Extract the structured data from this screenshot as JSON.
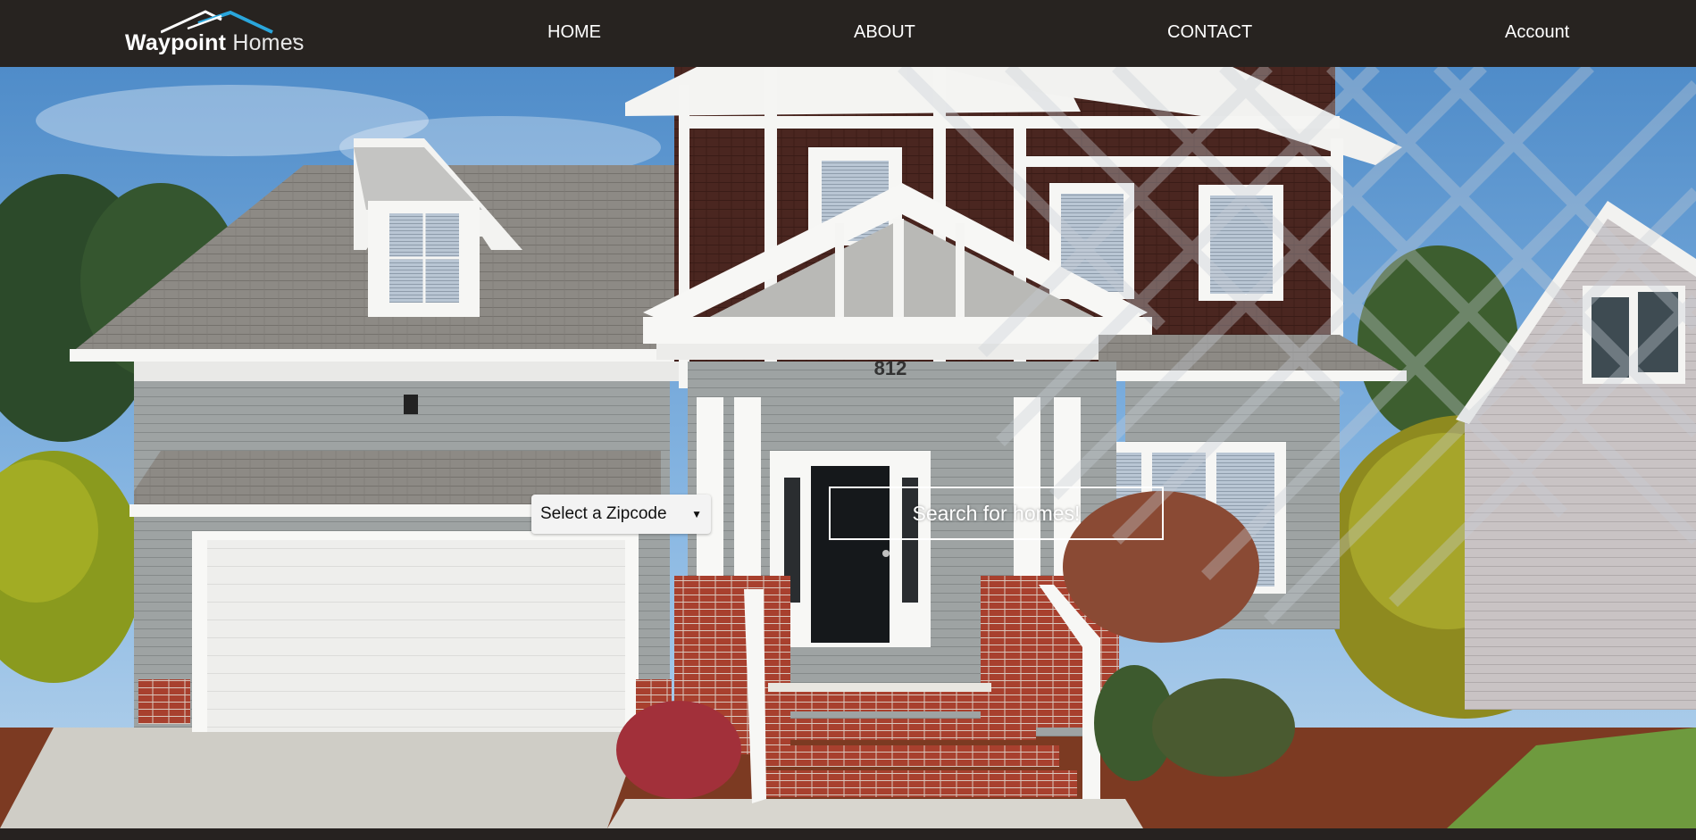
{
  "brand": {
    "name_part1": "Waypoint",
    "name_part2": "Homes",
    "roof_color": "#2aa6dc"
  },
  "nav": {
    "home": "HOME",
    "about": "ABOUT",
    "contact": "CONTACT",
    "account": "Account"
  },
  "hero": {
    "house_number": "812",
    "zipcode_select": {
      "selected": "Select a Zipcode",
      "arrow_icon": "caret-down-icon"
    },
    "search_button": "Search for homes!"
  },
  "colors": {
    "nav_bg": "#272320",
    "sky": "#6fa3d6",
    "siding_brown": "#4a2620",
    "siding_gray": "#9ea2a2",
    "roof_gray": "#8a8782",
    "trim_white": "#f6f6f4",
    "brick": "#a8402e"
  }
}
